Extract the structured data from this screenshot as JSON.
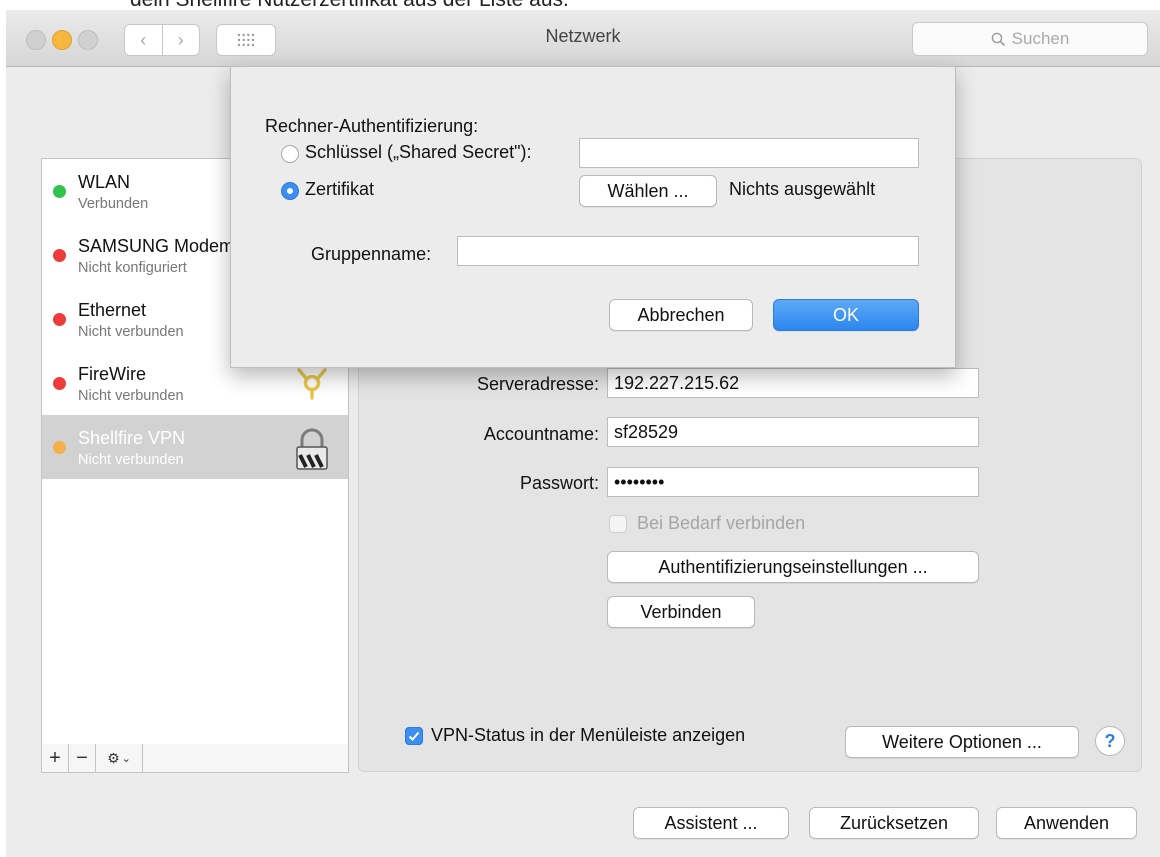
{
  "caption": "dein Shellfire Nutzerzertifikat aus der Liste aus.",
  "window": {
    "title": "Netzwerk",
    "search_placeholder": "Suchen"
  },
  "sidebar": {
    "items": [
      {
        "name": "WLAN",
        "status": "Verbunden",
        "color": "#30c24a"
      },
      {
        "name": "SAMSUNG Modem",
        "status": "Nicht konfiguriert",
        "color": "#ee3b3b"
      },
      {
        "name": "Ethernet",
        "status": "Nicht verbunden",
        "color": "#ee3b3b"
      },
      {
        "name": "FireWire",
        "status": "Nicht verbunden",
        "color": "#ee3b3b",
        "icon": "firewire-icon"
      },
      {
        "name": "Shellfire VPN",
        "status": "Nicht verbunden",
        "color": "#f5b04a",
        "icon": "lock-icon"
      }
    ],
    "add_label": "+",
    "remove_label": "−"
  },
  "sheet": {
    "title": "Rechner-Authentifizierung:",
    "shared_secret_label": "Schlüssel („Shared Secret\"):",
    "shared_secret_value": "",
    "certificate_label": "Zertifikat",
    "choose_button": "Wählen ...",
    "choose_status": "Nichts ausgewählt",
    "group_label": "Gruppenname:",
    "group_value": "",
    "cancel_button": "Abbrechen",
    "ok_button": "OK",
    "selected": "certificate"
  },
  "vpn": {
    "server_label": "Serveradresse:",
    "server_value": "192.227.215.62",
    "account_label": "Accountname:",
    "account_value": "sf28529",
    "password_label": "Passwort:",
    "password_value": "••••••••",
    "on_demand_label": "Bei Bedarf verbinden",
    "auth_button": "Authentifizierungseinstellungen ...",
    "connect_button": "Verbinden",
    "menubar_label": "VPN-Status in der Menüleiste anzeigen",
    "more_options_button": "Weitere Optionen ...",
    "help_label": "?"
  },
  "footer": {
    "assistant_button": "Assistent ...",
    "revert_button": "Zurücksetzen",
    "apply_button": "Anwenden"
  }
}
